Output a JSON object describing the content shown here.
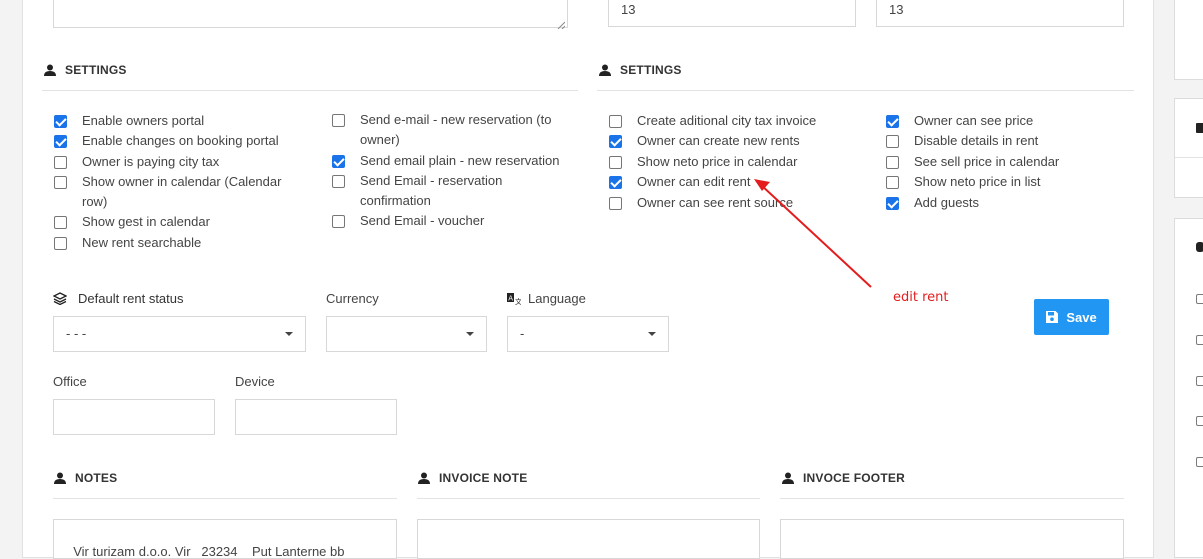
{
  "top_fields": {
    "value_1": "13",
    "value_2": "13"
  },
  "settings_left": {
    "title": "SETTINGS",
    "col1": [
      {
        "label": "Enable owners portal",
        "checked": true
      },
      {
        "label": "Enable changes on booking portal",
        "checked": true
      },
      {
        "label": "Owner is paying city tax",
        "checked": false
      },
      {
        "label": "Show owner in calendar (Calendar row)",
        "checked": false
      },
      {
        "label": "Show gest in calendar",
        "checked": false
      },
      {
        "label": "New rent searchable",
        "checked": false
      }
    ],
    "col2": [
      {
        "label": "Send e-mail - new reservation (to owner)",
        "checked": false
      },
      {
        "label": "Send email plain - new reservation",
        "checked": true
      },
      {
        "label": "Send Email - reservation confirmation",
        "checked": false
      },
      {
        "label": "Send Email - voucher",
        "checked": false
      }
    ]
  },
  "settings_right": {
    "title": "SETTINGS",
    "col1": [
      {
        "label": "Create aditional city tax invoice",
        "checked": false
      },
      {
        "label": "Owner can create new rents",
        "checked": true
      },
      {
        "label": "Show neto price in calendar",
        "checked": false
      },
      {
        "label": "Owner can edit rent",
        "checked": true
      },
      {
        "label": "Owner can see rent source",
        "checked": false
      }
    ],
    "col2": [
      {
        "label": "Owner can see price",
        "checked": true
      },
      {
        "label": "Disable details in rent",
        "checked": false
      },
      {
        "label": "See sell price in calendar",
        "checked": false
      },
      {
        "label": "Show neto price in list",
        "checked": false
      },
      {
        "label": "Add guests",
        "checked": true
      }
    ]
  },
  "form": {
    "default_rent_status_label": "Default rent status",
    "default_rent_status_value": "- - -",
    "currency_label": "Currency",
    "currency_value": "",
    "language_label": "Language",
    "language_value": "-",
    "office_label": "Office",
    "device_label": "Device",
    "save_label": "Save"
  },
  "annotation": {
    "text": "edit rent"
  },
  "notes": {
    "notes_title": "NOTES",
    "invoice_note_title": "INVOICE NOTE",
    "invoice_footer_title": "INVOCE FOOTER",
    "notes_value": "Vir turizam d.o.o. Vir   23234    Put Lanterne bb"
  },
  "colors": {
    "accent": "#2196f3",
    "checkbox": "#1a73e8",
    "annotation": "#e31d1d"
  }
}
